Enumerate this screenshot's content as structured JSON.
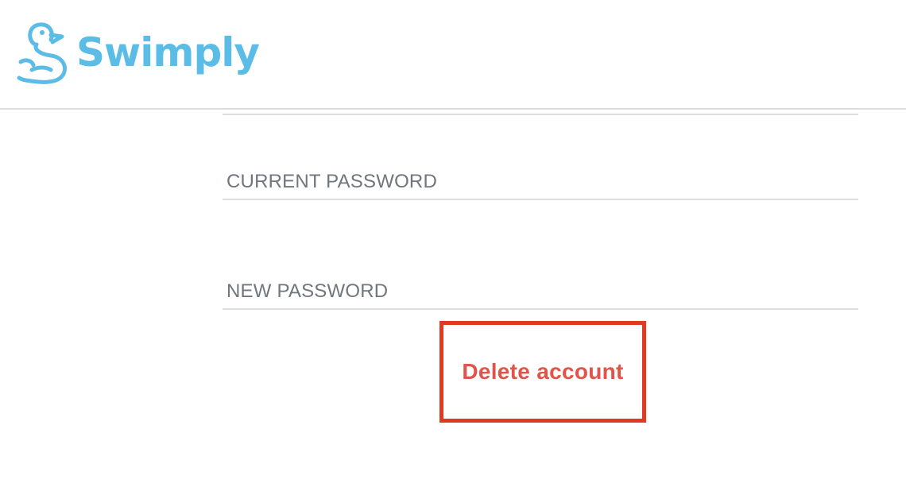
{
  "brand": {
    "name": "Swimply",
    "logo_icon": "duck-icon",
    "color": "#5bbde6"
  },
  "form": {
    "current_password_placeholder": "CURRENT PASSWORD",
    "new_password_placeholder": "NEW PASSWORD"
  },
  "actions": {
    "delete_account_label": "Delete account",
    "delete_color": "#e05449",
    "highlight_color": "#e03a22"
  }
}
